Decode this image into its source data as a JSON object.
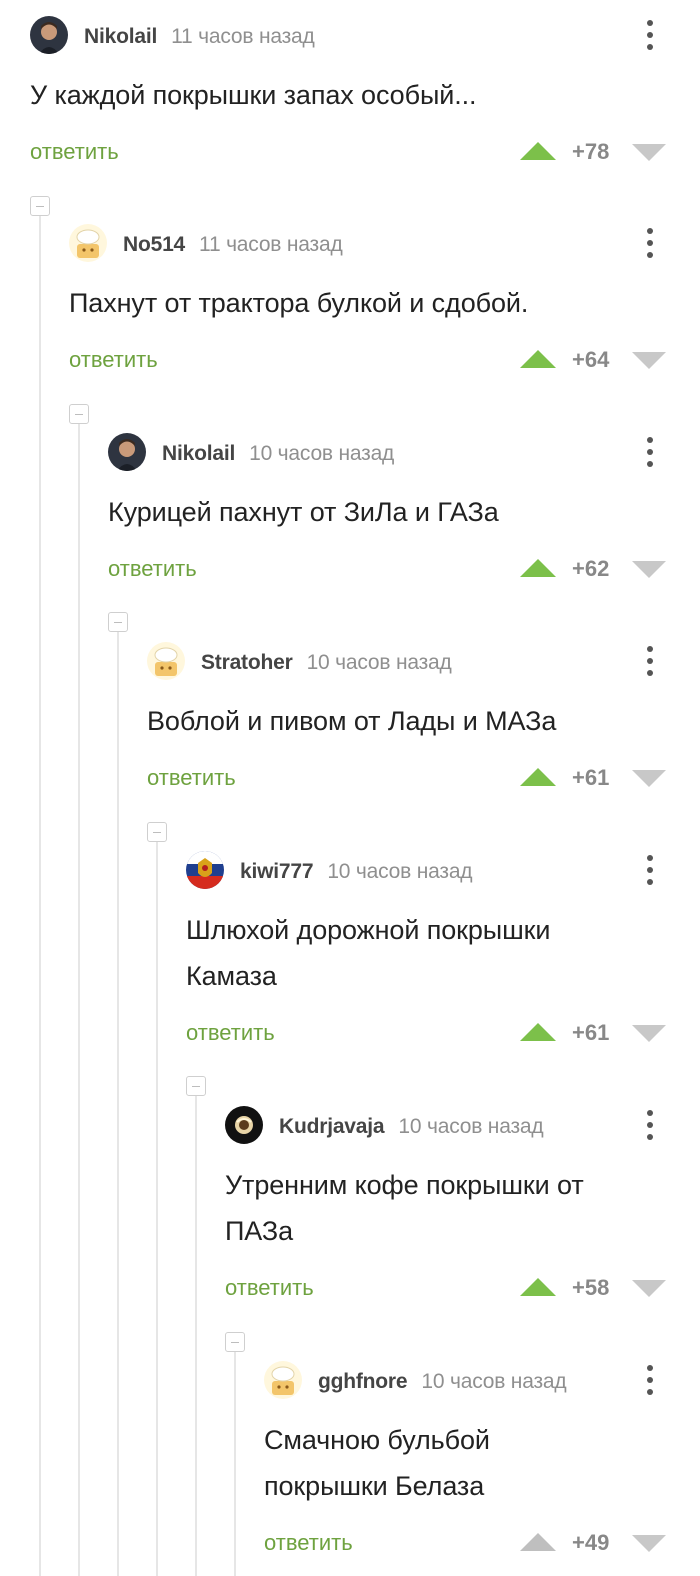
{
  "colors": {
    "accent": "#6ea23f",
    "upvote": "#7cc04a",
    "downvote": "#c8c8c8",
    "thread_line": "#e6e6e6"
  },
  "comments": [
    {
      "author": "Nikolail",
      "time": "11 часов назад",
      "lines": [
        "У каждой покрышки запах особый..."
      ],
      "reply": "ответить",
      "score": "+78",
      "avatar_icon": "user-photo-avatar"
    },
    {
      "author": "No514",
      "time": "11 часов назад",
      "lines": [
        "Пахнут от трактора булкой и сдобой."
      ],
      "reply": "ответить",
      "score": "+64",
      "avatar_icon": "default-chef-avatar"
    },
    {
      "author": "Nikolail",
      "time": "10 часов назад",
      "lines": [
        "Курицей пахнут от ЗиЛа и ГАЗа"
      ],
      "reply": "ответить",
      "score": "+62",
      "avatar_icon": "user-photo-avatar"
    },
    {
      "author": "Stratoher",
      "time": "10 часов назад",
      "lines": [
        "Воблой и пивом от Лады и МАЗа"
      ],
      "reply": "ответить",
      "score": "+61",
      "avatar_icon": "default-chef-avatar"
    },
    {
      "author": "kiwi777",
      "time": "10 часов назад",
      "lines": [
        "Шлюхой дорожной покрышки",
        "Камаза"
      ],
      "reply": "ответить",
      "score": "+61",
      "avatar_icon": "coat-of-arms-avatar"
    },
    {
      "author": "Kudrjavaja",
      "time": "10 часов назад",
      "lines": [
        "Утренним кофе покрышки от",
        "ПАЗа"
      ],
      "reply": "ответить",
      "score": "+58",
      "avatar_icon": "dark-round-avatar"
    },
    {
      "author": "gghfnore",
      "time": "10 часов назад",
      "lines": [
        "Смачною бульбой",
        "покрышки Белаза"
      ],
      "reply": "ответить",
      "score": "+49",
      "avatar_icon": "default-chef-avatar"
    }
  ]
}
